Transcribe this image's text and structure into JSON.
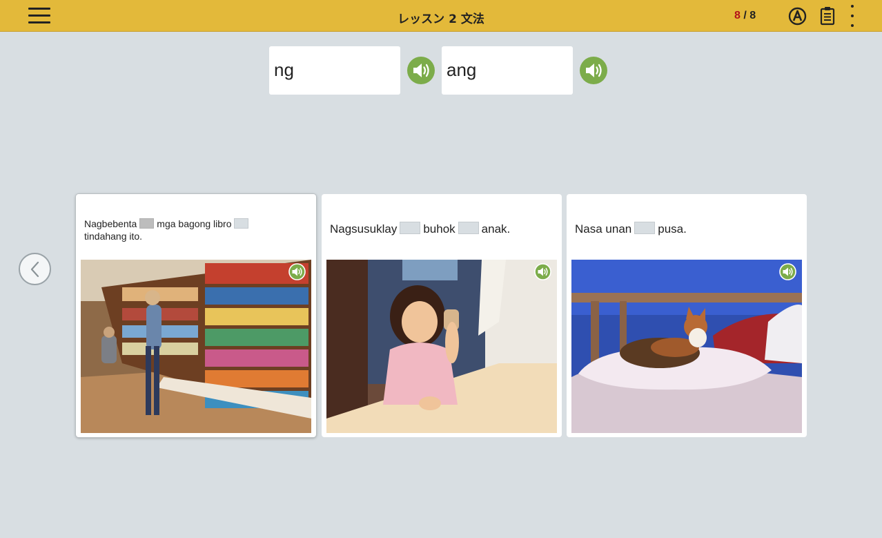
{
  "header": {
    "title": "レッスン 2 文法",
    "progress_current": "8",
    "progress_separator": " / ",
    "progress_total": "8",
    "menu_icon": "hamburger-menu-icon",
    "icons": [
      "auto-advance-a-icon",
      "clipboard-icon",
      "more-vertical-icon"
    ]
  },
  "word_bank": [
    {
      "word": "ng",
      "audio_icon": "speaker-icon"
    },
    {
      "word": "ang",
      "audio_icon": "speaker-icon"
    }
  ],
  "navigation": {
    "prev_icon": "chevron-left-icon"
  },
  "cards": [
    {
      "selected": true,
      "sentence_parts": [
        "Nagbebenta",
        "mga bagong libro",
        "tindahang ito."
      ],
      "photo": "bookstore-photo",
      "audio_icon": "speaker-icon"
    },
    {
      "selected": false,
      "sentence_parts": [
        "Nagsusuklay",
        "buhok",
        "anak."
      ],
      "photo": "girl-combing-hair-photo",
      "audio_icon": "speaker-icon"
    },
    {
      "selected": false,
      "sentence_parts": [
        "Nasa unan",
        "pusa."
      ],
      "photo": "cat-on-pillow-photo",
      "audio_icon": "speaker-icon"
    }
  ],
  "colors": {
    "header_bg": "#e3b93a",
    "page_bg": "#d8dee2",
    "speaker_green": "#7cac4a",
    "progress_current": "#b3121a"
  }
}
